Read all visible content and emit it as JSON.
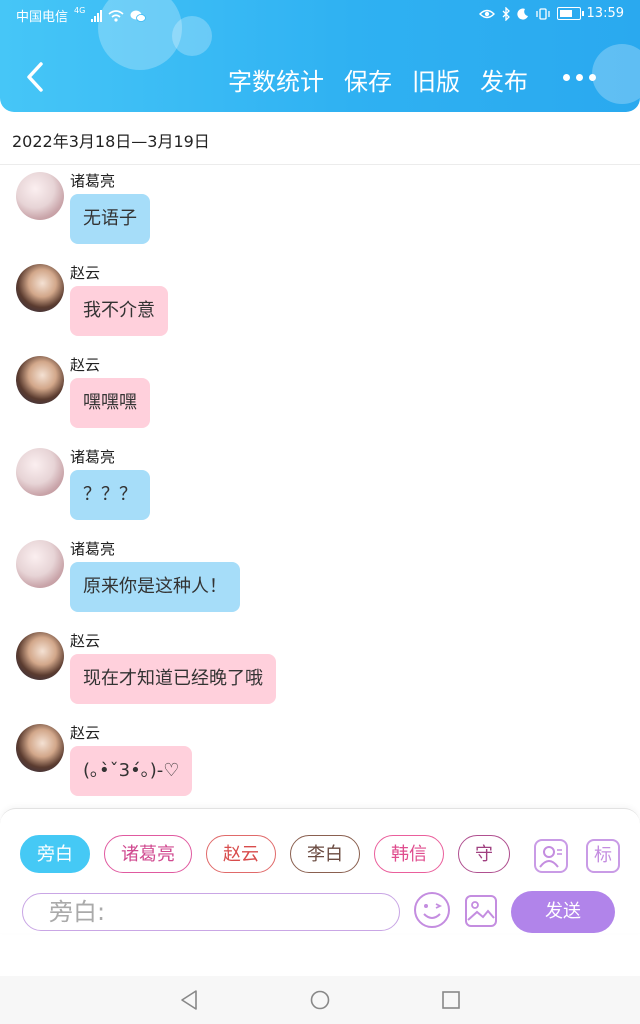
{
  "status_bar": {
    "carrier": "中国电信",
    "network": "4G",
    "time": "13:59"
  },
  "header": {
    "menu": [
      "字数统计",
      "保存",
      "旧版",
      "发布"
    ],
    "icons": {
      "back": "back-arrow-icon",
      "more": "more-dots-icon"
    }
  },
  "date_range": "2022年3月18日—3月19日",
  "messages": [
    {
      "speaker": "诸葛亮",
      "text": "无语子"
    },
    {
      "speaker": "赵云",
      "text": "我不介意"
    },
    {
      "speaker": "赵云",
      "text": "嘿嘿嘿"
    },
    {
      "speaker": "诸葛亮",
      "text": "？？？"
    },
    {
      "speaker": "诸葛亮",
      "text": "原来你是这种人！"
    },
    {
      "speaker": "赵云",
      "text": "现在才知道已经晚了哦"
    },
    {
      "speaker": "赵云",
      "text": "(｡•̀ˇ3•́｡)-♡"
    }
  ],
  "characters": {
    "chips": [
      "旁白",
      "诸葛亮",
      "赵云",
      "李白",
      "韩信",
      "守"
    ],
    "selected": "旁白"
  },
  "input": {
    "placeholder": "旁白:"
  },
  "toolbar": {
    "label_icon_text": "标",
    "send_label": "发送"
  },
  "colors": {
    "header": "#2fb1f2",
    "bubble_zhuge": "#a6ddf9",
    "bubble_zhaoyun": "#ffd0dc",
    "send_button": "#b184ea"
  }
}
